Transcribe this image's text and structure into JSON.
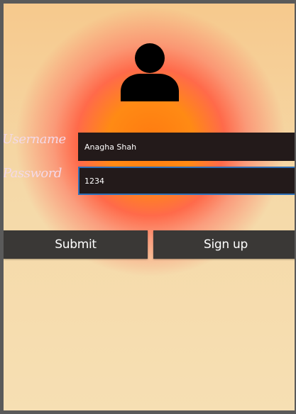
{
  "form": {
    "username_label": "Username",
    "password_label": "Password",
    "username_value": "Anagha Shah",
    "password_value": "1234",
    "submit_label": "Submit",
    "signup_label": "Sign up"
  },
  "icons": {
    "avatar": "user-icon"
  },
  "colors": {
    "field_background": "#231a1a",
    "button_background": "#3a3836",
    "focus_border": "#2d6fb8",
    "label_text": "#f3d9e8"
  }
}
